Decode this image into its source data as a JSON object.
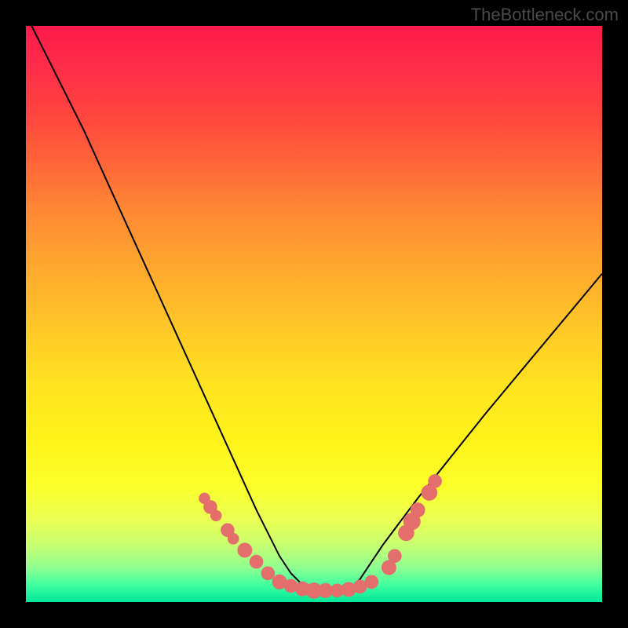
{
  "watermark": "TheBottleneck.com",
  "colors": {
    "background": "#000000",
    "curve_stroke": "#000000",
    "marker_fill": "#e36e6b"
  },
  "chart_data": {
    "type": "line",
    "title": "",
    "xlabel": "",
    "ylabel": "",
    "xlim": [
      0,
      100
    ],
    "ylim": [
      0,
      100
    ],
    "series": [
      {
        "name": "bottleneck-curve",
        "x": [
          1,
          5,
          10,
          15,
          20,
          25,
          30,
          35,
          40,
          42,
          44,
          46,
          48,
          50,
          52,
          54,
          56,
          58,
          60,
          62,
          65,
          68,
          72,
          76,
          80,
          85,
          90,
          95,
          100
        ],
        "y": [
          100,
          92,
          82,
          71,
          60,
          49,
          38,
          27,
          16,
          12,
          8,
          5,
          3,
          2,
          2,
          2,
          2,
          4,
          7,
          10,
          14,
          18,
          23,
          28,
          33,
          39,
          45,
          51,
          57
        ]
      }
    ],
    "markers": [
      {
        "x": 31,
        "y": 18,
        "r": 1.0
      },
      {
        "x": 32,
        "y": 16.5,
        "r": 1.2
      },
      {
        "x": 33,
        "y": 15,
        "r": 1.0
      },
      {
        "x": 35,
        "y": 12.5,
        "r": 1.2
      },
      {
        "x": 36,
        "y": 11,
        "r": 1.0
      },
      {
        "x": 38,
        "y": 9,
        "r": 1.3
      },
      {
        "x": 40,
        "y": 7,
        "r": 1.2
      },
      {
        "x": 42,
        "y": 5,
        "r": 1.2
      },
      {
        "x": 44,
        "y": 3.5,
        "r": 1.3
      },
      {
        "x": 46,
        "y": 2.8,
        "r": 1.2
      },
      {
        "x": 48,
        "y": 2.3,
        "r": 1.3
      },
      {
        "x": 50,
        "y": 2.0,
        "r": 1.4
      },
      {
        "x": 52,
        "y": 2.0,
        "r": 1.3
      },
      {
        "x": 54,
        "y": 2.0,
        "r": 1.2
      },
      {
        "x": 56,
        "y": 2.2,
        "r": 1.3
      },
      {
        "x": 58,
        "y": 2.7,
        "r": 1.2
      },
      {
        "x": 60,
        "y": 3.5,
        "r": 1.2
      },
      {
        "x": 63,
        "y": 6,
        "r": 1.3
      },
      {
        "x": 64,
        "y": 8,
        "r": 1.2
      },
      {
        "x": 66,
        "y": 12,
        "r": 1.4
      },
      {
        "x": 67,
        "y": 14,
        "r": 1.5
      },
      {
        "x": 68,
        "y": 16,
        "r": 1.3
      },
      {
        "x": 70,
        "y": 19,
        "r": 1.4
      },
      {
        "x": 71,
        "y": 21,
        "r": 1.2
      }
    ],
    "background_gradient": {
      "type": "vertical",
      "stops": [
        {
          "pct": 0,
          "color": "#ff1a4a"
        },
        {
          "pct": 50,
          "color": "#ffc628"
        },
        {
          "pct": 80,
          "color": "#fbff2a"
        },
        {
          "pct": 100,
          "color": "#00e89a"
        }
      ]
    }
  }
}
